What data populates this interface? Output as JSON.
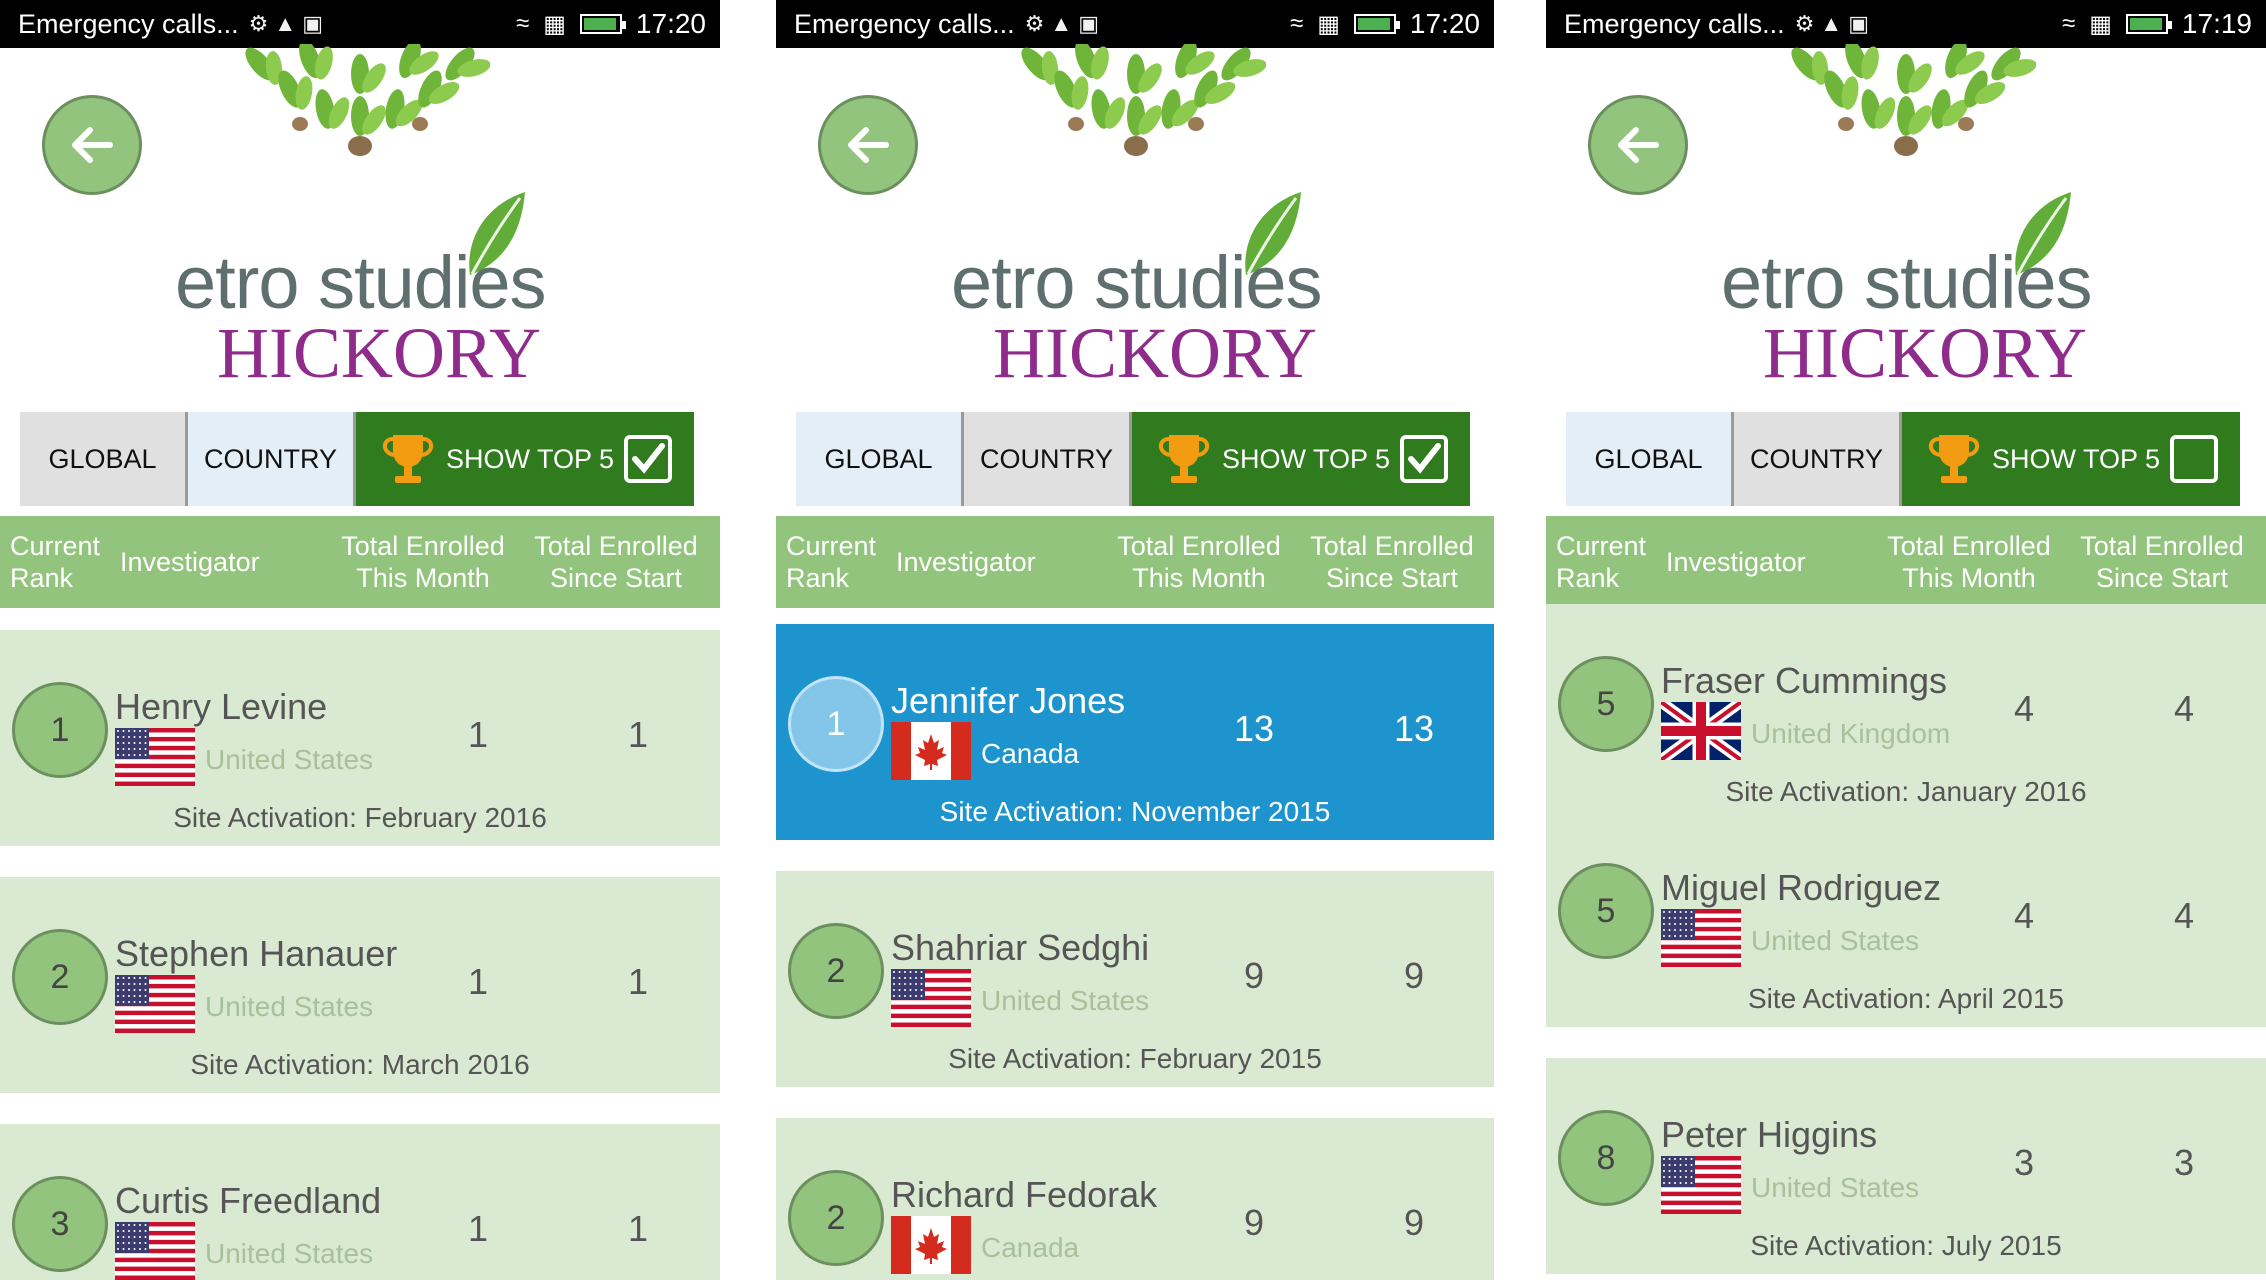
{
  "screens": [
    {
      "status": {
        "text": "Emergency calls...",
        "time": "17:20"
      },
      "tabs": {
        "global": "GLOBAL",
        "country": "COUNTRY",
        "top5": "SHOW TOP 5"
      },
      "top5_checked": true,
      "header": {
        "rank": "Current\nRank",
        "investigator": "Investigator",
        "month": "Total Enrolled\nThis Month",
        "start": "Total Enrolled\nSince Start"
      },
      "logo": {
        "line1": "etro studies",
        "line2": "HICKORY"
      },
      "rows": [
        {
          "rank": "1",
          "name": "Henry Levine",
          "flag": "us-flag-icon",
          "country": "United States",
          "month": "1",
          "start": "1",
          "activation": "Site Activation: February 2016",
          "selected": false
        },
        {
          "rank": "2",
          "name": "Stephen Hanauer",
          "flag": "us-flag-icon",
          "country": "United States",
          "month": "1",
          "start": "1",
          "activation": "Site Activation: March 2016",
          "selected": false
        },
        {
          "rank": "3",
          "name": "Curtis Freedland",
          "flag": "us-flag-icon",
          "country": "United States",
          "month": "1",
          "start": "1",
          "activation": "",
          "selected": false
        }
      ]
    },
    {
      "status": {
        "text": "Emergency calls...",
        "time": "17:20"
      },
      "tabs": {
        "global": "GLOBAL",
        "country": "COUNTRY",
        "top5": "SHOW TOP 5"
      },
      "top5_checked": true,
      "header": {
        "rank": "Current\nRank",
        "investigator": "Investigator",
        "month": "Total Enrolled\nThis Month",
        "start": "Total Enrolled\nSince Start"
      },
      "logo": {
        "line1": "etro studies",
        "line2": "HICKORY"
      },
      "rows": [
        {
          "rank": "1",
          "name": "Jennifer Jones",
          "flag": "canada-flag-icon",
          "country": "Canada",
          "month": "13",
          "start": "13",
          "activation": "Site Activation: November 2015",
          "selected": true
        },
        {
          "rank": "2",
          "name": "Shahriar Sedghi",
          "flag": "us-flag-icon",
          "country": "United States",
          "month": "9",
          "start": "9",
          "activation": "Site Activation: February 2015",
          "selected": false
        },
        {
          "rank": "2",
          "name": "Richard Fedorak",
          "flag": "canada-flag-icon",
          "country": "Canada",
          "month": "9",
          "start": "9",
          "activation": "",
          "selected": false
        }
      ]
    },
    {
      "status": {
        "text": "Emergency calls...",
        "time": "17:19"
      },
      "tabs": {
        "global": "GLOBAL",
        "country": "COUNTRY",
        "top5": "SHOW TOP 5"
      },
      "top5_checked": false,
      "header": {
        "rank": "Current\nRank",
        "investigator": "Investigator",
        "month": "Total Enrolled\nThis Month",
        "start": "Total Enrolled\nSince Start"
      },
      "logo": {
        "line1": "etro studies",
        "line2": "HICKORY"
      },
      "rows": [
        {
          "rank": "5",
          "name": "Fraser Cummings",
          "flag": "uk-flag-icon",
          "country": "United Kingdom",
          "month": "4",
          "start": "4",
          "activation": "Site Activation: January 2016",
          "selected": false
        },
        {
          "rank": "5",
          "name": "Miguel Rodriguez",
          "flag": "us-flag-icon",
          "country": "United States",
          "month": "4",
          "start": "4",
          "activation": "Site Activation: April 2015",
          "selected": false
        },
        {
          "rank": "8",
          "name": "Peter Higgins",
          "flag": "us-flag-icon",
          "country": "United States",
          "month": "3",
          "start": "3",
          "activation": "Site Activation: July 2015",
          "selected": false
        }
      ]
    }
  ],
  "colors": {
    "header_green": "#93c47d",
    "row_green": "#d9e9d2",
    "selected_blue": "#1e94ce",
    "button_green": "#2f7b1e",
    "hickory_purple": "#8e2b8b"
  }
}
